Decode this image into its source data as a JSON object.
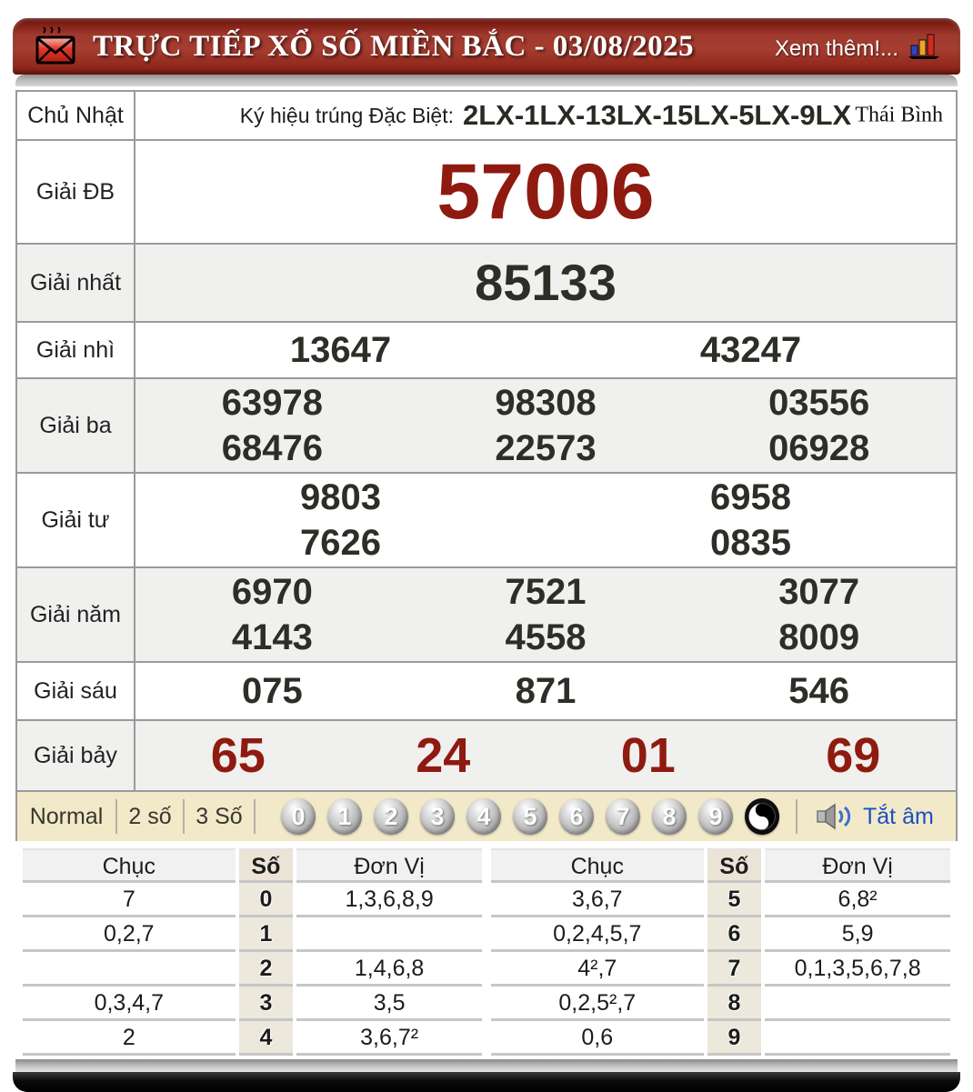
{
  "header": {
    "title": "TRỰC TIẾP XỔ SỐ MIỀN BẮC - 03/08/2025",
    "more_label": "Xem thêm!..."
  },
  "info": {
    "day": "Chủ Nhật",
    "sign_label": "Ký hiệu trúng Đặc Biệt:",
    "sign_value": "2LX-1LX-13LX-15LX-5LX-9LX",
    "province": "Thái Bình"
  },
  "results": {
    "db_label": "Giải ĐB",
    "db_value": "57006",
    "nhat_label": "Giải nhất",
    "nhat_value": "85133",
    "nhi_label": "Giải nhì",
    "nhi": [
      "13647",
      "43247"
    ],
    "ba_label": "Giải ba",
    "ba1": [
      "63978",
      "98308",
      "03556"
    ],
    "ba2": [
      "68476",
      "22573",
      "06928"
    ],
    "tu_label": "Giải tư",
    "tu1": [
      "9803",
      "6958"
    ],
    "tu2": [
      "7626",
      "0835"
    ],
    "nam_label": "Giải năm",
    "nam1": [
      "6970",
      "7521",
      "3077"
    ],
    "nam2": [
      "4143",
      "4558",
      "8009"
    ],
    "sau_label": "Giải sáu",
    "sau": [
      "075",
      "871",
      "546"
    ],
    "bay_label": "Giải bảy",
    "bay": [
      "65",
      "24",
      "01",
      "69"
    ]
  },
  "controls": {
    "modes": [
      "Normal",
      "2 số",
      "3 Số"
    ],
    "balls": [
      "0",
      "1",
      "2",
      "3",
      "4",
      "5",
      "6",
      "7",
      "8",
      "9"
    ],
    "mute_label": "Tắt âm"
  },
  "stats": {
    "col_tens": "Chục",
    "col_digit": "Số",
    "col_units": "Đơn Vị",
    "left": [
      {
        "tens": "7",
        "digit": "0",
        "units": "1,3,6,8,9"
      },
      {
        "tens": "0,2,7",
        "digit": "1",
        "units": ""
      },
      {
        "tens": "",
        "digit": "2",
        "units": "1,4,6,8"
      },
      {
        "tens": "0,3,4,7",
        "digit": "3",
        "units": "3,5"
      },
      {
        "tens": "2",
        "digit": "4",
        "units": "3,6,7²"
      }
    ],
    "right": [
      {
        "tens": "3,6,7",
        "digit": "5",
        "units": "6,8²"
      },
      {
        "tens": "0,2,4,5,7",
        "digit": "6",
        "units": "5,9"
      },
      {
        "tens": "4²,7",
        "digit": "7",
        "units": "0,1,3,5,6,7,8"
      },
      {
        "tens": "0,2,5²,7",
        "digit": "8",
        "units": ""
      },
      {
        "tens": "0,6",
        "digit": "9",
        "units": ""
      }
    ]
  },
  "colors": {
    "header_red": "#9c2f24",
    "accent_red": "#8f1a10",
    "control_bg": "#f2e9c9",
    "link_blue": "#1b4fc4"
  }
}
